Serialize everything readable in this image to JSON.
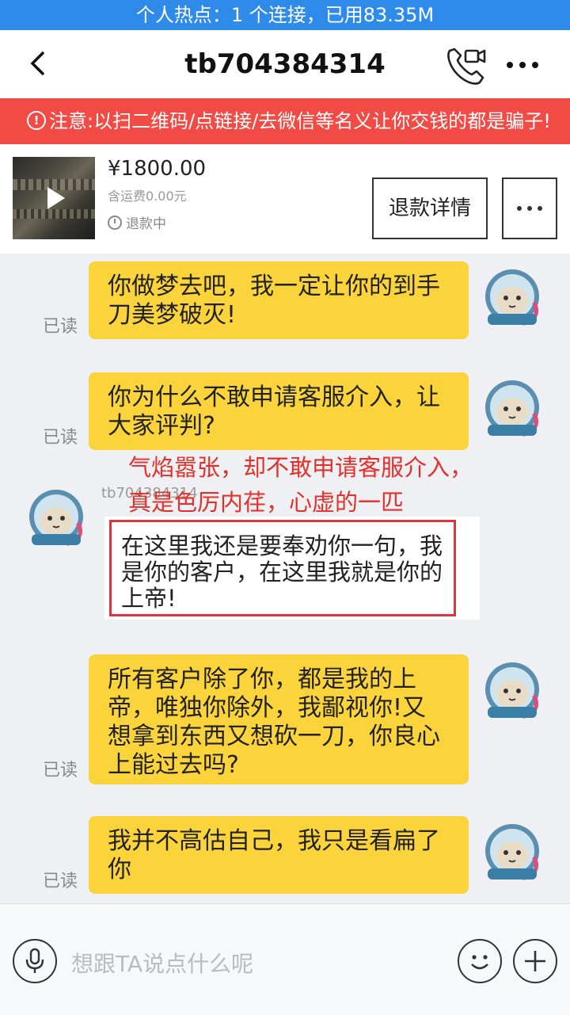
{
  "status_bar": {
    "text": "个人热点：1 个连接，已用83.35M"
  },
  "header": {
    "title": "tb704384314",
    "back_icon": "back-arrow-icon",
    "call_icon": "video-call-icon",
    "more_icon": "more-dots-icon"
  },
  "warning": {
    "icon": "alert-circle-icon",
    "text": "注意:以扫二维码/点链接/去微信等名义让你交钱的都是骗子!"
  },
  "product": {
    "price": "¥1800.00",
    "shipping": "含运费0.00元",
    "status": "退款中",
    "refund_button": "退款详情"
  },
  "messages": [
    {
      "side": "right",
      "text": "你做梦去吧，我一定让你的到手刀美梦破灭!",
      "read": "已读"
    },
    {
      "side": "right",
      "text": "你为什么不敢申请客服介入，让大家评判?",
      "read": "已读"
    },
    {
      "side": "left",
      "sender": "tb704384314",
      "text": "在这里我还是要奉劝你一句，我是你的客户，在这里我就是你的上帝!"
    },
    {
      "side": "right",
      "text": "所有客户除了你，都是我的上帝，唯独你除外，我鄙视你!又想拿到东西又想砍一刀，你良心上能过去吗?",
      "read": "已读"
    },
    {
      "side": "right",
      "text": "我并不高估自己，我只是看扁了你",
      "read": "已读"
    }
  ],
  "annotation": {
    "line1": "气焰嚣张，却不敢申请客服介入，",
    "line2": "真是色厉内荏，心虚的一匹"
  },
  "input": {
    "placeholder": "想跟TA说点什么呢"
  },
  "colors": {
    "status_bar": "#2f8bea",
    "warning": "#f24a45",
    "bubble": "#fbd33a",
    "annotation": "#e5302a"
  }
}
